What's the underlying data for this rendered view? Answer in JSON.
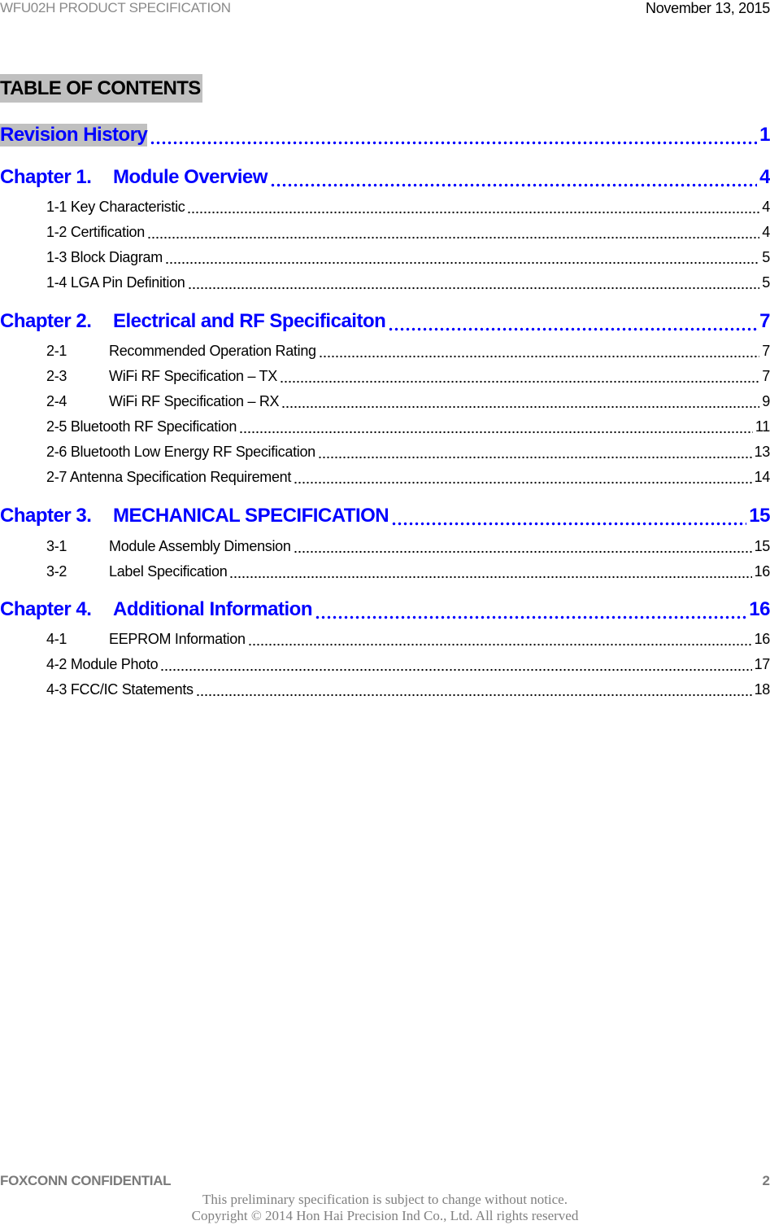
{
  "header": {
    "doc_title": "WFU02H PRODUCT SPECIFICATION",
    "date": "November 13, 2015"
  },
  "toc_title": "TABLE OF CONTENTS",
  "colors": {
    "link": "#0000ff",
    "highlight": "#c0c0c0"
  },
  "entries": [
    {
      "level": 1,
      "number": "",
      "title": "Revision History",
      "page": "1",
      "highlight": true
    },
    {
      "level": 1,
      "number": "Chapter 1.",
      "title": "Module Overview",
      "page": "4"
    },
    {
      "level": 2,
      "number": "",
      "title": "1-1 Key Characteristic",
      "page": "4"
    },
    {
      "level": 2,
      "number": "",
      "title": "1-2 Certification",
      "page": "4"
    },
    {
      "level": 2,
      "number": "",
      "title": "1-3 Block Diagram",
      "page": "5"
    },
    {
      "level": 2,
      "number": "",
      "title": "1-4 LGA Pin Definition",
      "page": "5"
    },
    {
      "level": 1,
      "number": "Chapter 2.",
      "title": "Electrical and RF Specificaiton",
      "page": "7"
    },
    {
      "level": 2,
      "number": "2-1",
      "title": "Recommended Operation Rating",
      "page": "7"
    },
    {
      "level": 2,
      "number": "2-3",
      "title": "WiFi RF Specification – TX",
      "page": "7"
    },
    {
      "level": 2,
      "number": "2-4",
      "title": "WiFi RF Specification – RX",
      "page": "9"
    },
    {
      "level": 2,
      "number": "",
      "title": "2-5 Bluetooth RF Specification",
      "page": "11"
    },
    {
      "level": 2,
      "number": "",
      "title": "2-6 Bluetooth Low Energy RF Specification",
      "page": "13"
    },
    {
      "level": 2,
      "number": "",
      "title": "2-7 Antenna Specification Requirement",
      "page": "14"
    },
    {
      "level": 1,
      "number": "Chapter 3.",
      "title": "MECHANICAL SPECIFICATION",
      "page": "15"
    },
    {
      "level": 2,
      "number": "3-1",
      "title": "Module Assembly Dimension",
      "page": "15"
    },
    {
      "level": 2,
      "number": "3-2",
      "title": "Label Specification",
      "page": "16"
    },
    {
      "level": 1,
      "number": "Chapter 4.",
      "title": "Additional Information",
      "page": "16"
    },
    {
      "level": 2,
      "number": "4-1",
      "title": "EEPROM Information",
      "page": "16"
    },
    {
      "level": 2,
      "number": "",
      "title": "4-2 Module Photo",
      "page": "17"
    },
    {
      "level": 2,
      "number": "",
      "title": "4-3 FCC/IC Statements",
      "page": "18"
    }
  ],
  "footer": {
    "confidential": "FOXCONN CONFIDENTIAL",
    "page_number": "2",
    "notice": "This preliminary specification is subject to change without notice.",
    "copyright": "Copyright © 2014 Hon Hai Precision Ind Co., Ltd. All rights reserved"
  }
}
